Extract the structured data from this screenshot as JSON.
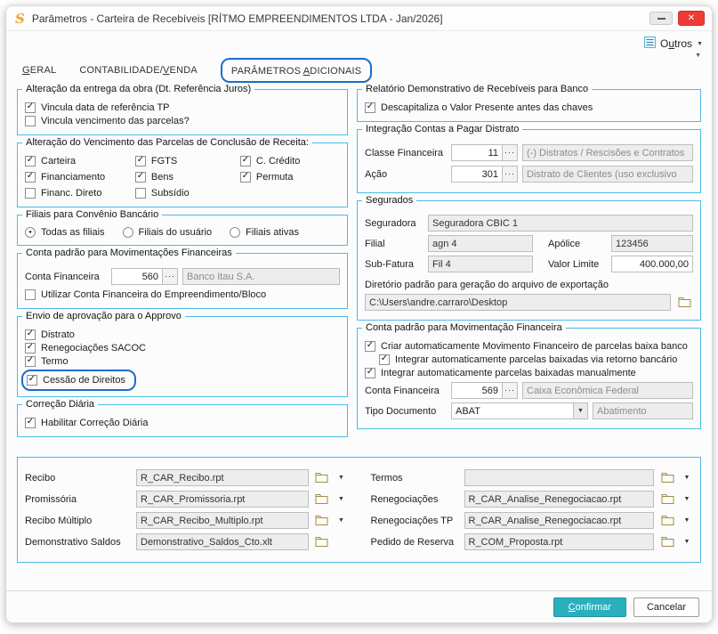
{
  "window": {
    "title": "Parâmetros - Carteira de Recebíveis [RÍTMO EMPREENDIMENTOS LTDA - Jan/2026]",
    "icon_glyph": "S"
  },
  "ui": {
    "check": "✓",
    "radio_dot": "●",
    "ellipsis": "···",
    "caret": "▼",
    "mini_caret": "▼",
    "close": "✕"
  },
  "toolbar": {
    "outros": "Outros"
  },
  "tabs": {
    "geral": "GERAL",
    "contab": "CONTABILIDADE/VENDA",
    "param": "PARÂMETROS ADICIONAIS"
  },
  "left": {
    "g1": {
      "title": "Alteração da entrega da obra (Dt. Referência Juros)",
      "items": [
        {
          "mark": "✓",
          "label": "Vincula data de referência TP"
        },
        {
          "mark": "",
          "label": "Vincula vencimento das parcelas?"
        }
      ]
    },
    "g2": {
      "title": "Alteração do Vencimento das Parcelas de Conclusão de Receita:",
      "items": [
        {
          "mark": "✓",
          "label": "Carteira"
        },
        {
          "mark": "✓",
          "label": "FGTS"
        },
        {
          "mark": "✓",
          "label": "C. Crédito"
        },
        {
          "mark": "✓",
          "label": "Financiamento"
        },
        {
          "mark": "✓",
          "label": "Bens"
        },
        {
          "mark": "✓",
          "label": "Permuta"
        },
        {
          "mark": "",
          "label": "Financ. Direto"
        },
        {
          "mark": "",
          "label": "Subsídio"
        }
      ]
    },
    "g3": {
      "title": "Filiais para Convênio Bancário",
      "options": [
        {
          "dot": "●",
          "label": "Todas as filiais"
        },
        {
          "dot": "",
          "label": "Filiais do usuário"
        },
        {
          "dot": "",
          "label": "Filiais ativas"
        }
      ]
    },
    "g4": {
      "title": "Conta padrão para Movimentações Financeiras",
      "conta_label": "Conta Financeira",
      "conta_value": "560",
      "banco": "Banco Itau S.A.",
      "check": {
        "mark": "",
        "label": "Utilizar Conta Financeira do Empreendimento/Bloco"
      }
    },
    "g5": {
      "title": "Envio de aprovação para o Approvo",
      "items": [
        {
          "mark": "✓",
          "label": "Distrato"
        },
        {
          "mark": "✓",
          "label": "Renegociações SACOC"
        },
        {
          "mark": "✓",
          "label": "Termo"
        },
        {
          "mark": "✓",
          "label": "Cessão de Direitos"
        }
      ]
    },
    "g6": {
      "title": "Correção Diária",
      "items": [
        {
          "mark": "✓",
          "label": "Habilitar Correção Diária"
        }
      ]
    }
  },
  "right": {
    "g1": {
      "title": "Relatório Demonstrativo de Recebíveis para Banco",
      "items": [
        {
          "mark": "✓",
          "label": "Descapitaliza o Valor Presente antes das chaves"
        }
      ]
    },
    "g2": {
      "title": "Integração Contas a Pagar Distrato",
      "rows": [
        {
          "label": "Classe Financeira",
          "value": "11",
          "desc": "(-) Distratos / Rescisões e Contratos"
        },
        {
          "label": "Ação",
          "value": "301",
          "desc": "Distrato de Clientes (uso exclusivo"
        }
      ]
    },
    "g3": {
      "title": "Segurados",
      "seguradora_label": "Seguradora",
      "seguradora_value": "Seguradora CBIC 1",
      "filial_label": "Filial",
      "filial_value": "agn 4",
      "apolice_label": "Apólice",
      "apolice_value": "123456",
      "subfatura_label": "Sub-Fatura",
      "subfatura_value": "Fil 4",
      "valor_label": "Valor Limite",
      "valor_value": "400.000,00",
      "dir_label": "Diretório padrão para geração do arquivo de exportação",
      "dir_value": "C:\\Users\\andre.carraro\\Desktop"
    },
    "g4": {
      "title": "Conta padrão para Movimentação Financeira",
      "checks": [
        {
          "mark": "✓",
          "label": "Criar automaticamente Movimento Financeiro de parcelas baixa banco"
        },
        {
          "mark": "✓",
          "label": "Integrar automaticamente parcelas baixadas via retorno bancário"
        },
        {
          "mark": "✓",
          "label": "Integrar automaticamente parcelas baixadas manualmente"
        }
      ],
      "conta_label": "Conta Financeira",
      "conta_value": "569",
      "banco": "Caixa Econômica Federal",
      "tipo_label": "Tipo Documento",
      "tipo_value": "ABAT",
      "tipo_desc": "Abatimento"
    }
  },
  "reports": {
    "left": [
      {
        "label": "Recibo",
        "value": "R_CAR_Recibo.rpt"
      },
      {
        "label": "Promissória",
        "value": "R_CAR_Promissoria.rpt"
      },
      {
        "label": "Recibo Múltiplo",
        "value": "R_CAR_Recibo_Multiplo.rpt"
      },
      {
        "label": "Demonstrativo Saldos",
        "value": "Demonstrativo_Saldos_Cto.xlt"
      }
    ],
    "right": [
      {
        "label": "Termos",
        "value": ""
      },
      {
        "label": "Renegociações",
        "value": "R_CAR_Analise_Renegociacao.rpt"
      },
      {
        "label": "Renegociações TP",
        "value": "R_CAR_Analise_Renegociacao.rpt"
      },
      {
        "label": "Pedido de Reserva",
        "value": "R_COM_Proposta.rpt"
      }
    ]
  },
  "footer": {
    "confirm": "Confirmar",
    "cancel": "Cancelar"
  }
}
